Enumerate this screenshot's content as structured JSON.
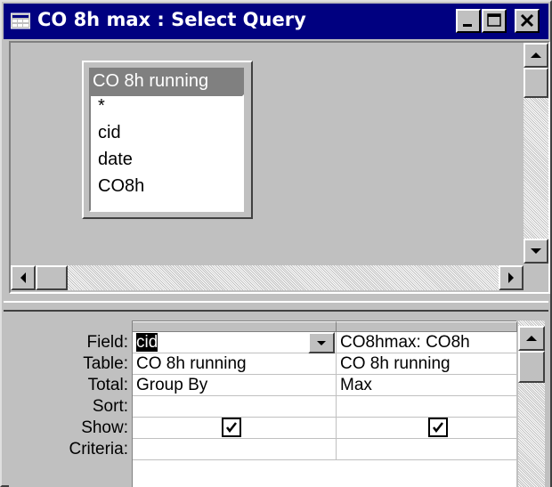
{
  "window": {
    "title": "CO 8h max : Select Query",
    "icon": "query-icon",
    "controls": [
      "minimize-icon",
      "maximize-icon",
      "close-icon"
    ]
  },
  "table_pane": {
    "field_list": {
      "title": "CO 8h running",
      "fields": [
        "*",
        "cid",
        "date",
        "CO8h"
      ]
    }
  },
  "grid": {
    "row_labels": {
      "field": "Field:",
      "table": "Table:",
      "total": "Total:",
      "sort": "Sort:",
      "show": "Show:",
      "criteria": "Criteria:"
    },
    "columns": [
      {
        "field": "cid",
        "table": "CO 8h running",
        "total": "Group By",
        "sort": "",
        "show": true,
        "criteria": ""
      },
      {
        "field": "CO8hmax: CO8h",
        "table": "CO 8h running",
        "total": "Max",
        "sort": "",
        "show": true,
        "criteria": ""
      }
    ]
  }
}
